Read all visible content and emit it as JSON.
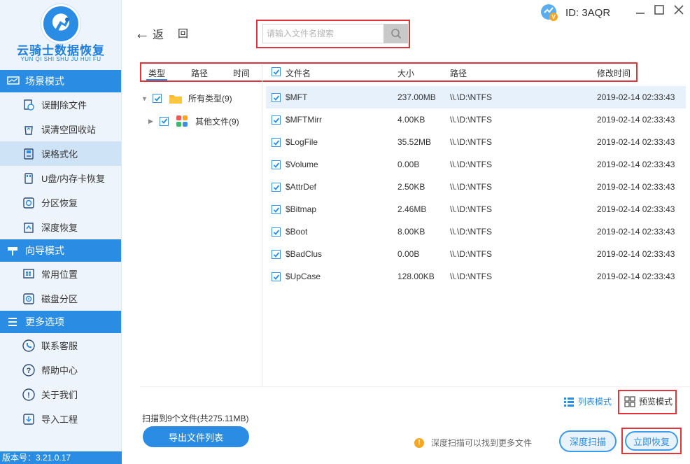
{
  "app": {
    "logo_title": "云骑士数据恢复",
    "logo_subtitle": "YUN QI SHI SHU JU HUI FU",
    "version": "版本号：3.21.0.17",
    "user_id": "ID: 3AQR"
  },
  "sidebar": {
    "sections": [
      {
        "title": "场景模式",
        "items": [
          {
            "label": "误删除文件",
            "icon": "deleted-file-icon"
          },
          {
            "label": "误清空回收站",
            "icon": "recycle-bin-icon"
          },
          {
            "label": "误格式化",
            "icon": "format-drive-icon",
            "active": true
          },
          {
            "label": "U盘/内存卡恢复",
            "icon": "usb-card-icon"
          },
          {
            "label": "分区恢复",
            "icon": "partition-icon"
          },
          {
            "label": "深度恢复",
            "icon": "deep-recover-icon"
          }
        ]
      },
      {
        "title": "向导模式",
        "items": [
          {
            "label": "常用位置",
            "icon": "windows-icon"
          },
          {
            "label": "磁盘分区",
            "icon": "disk-icon"
          }
        ]
      },
      {
        "title": "更多选项",
        "items": [
          {
            "label": "联系客服",
            "icon": "phone-icon"
          },
          {
            "label": "帮助中心",
            "icon": "help-icon"
          },
          {
            "label": "关于我们",
            "icon": "info-icon"
          },
          {
            "label": "导入工程",
            "icon": "import-icon"
          }
        ]
      }
    ]
  },
  "toolbar": {
    "back_label": "返",
    "undo_label": "回",
    "search_placeholder": "请输入文件名搜索"
  },
  "filter_headers": {
    "type": "类型",
    "path": "路径",
    "time": "时间"
  },
  "tree": [
    {
      "label": "所有类型(9)",
      "checked": true,
      "expanded": true
    },
    {
      "label": "其他文件(9)",
      "checked": true,
      "expanded": false
    }
  ],
  "table": {
    "headers": {
      "name": "文件名",
      "size": "大小",
      "path": "路径",
      "modified": "修改时间"
    },
    "rows": [
      {
        "name": "$MFT",
        "size": "237.00MB",
        "path": "\\\\.\\D:\\NTFS",
        "modified": "2019-02-14 02:33:43",
        "selected": true
      },
      {
        "name": "$MFTMirr",
        "size": "4.00KB",
        "path": "\\\\.\\D:\\NTFS",
        "modified": "2019-02-14 02:33:43"
      },
      {
        "name": "$LogFile",
        "size": "35.52MB",
        "path": "\\\\.\\D:\\NTFS",
        "modified": "2019-02-14 02:33:43"
      },
      {
        "name": "$Volume",
        "size": "0.00B",
        "path": "\\\\.\\D:\\NTFS",
        "modified": "2019-02-14 02:33:43"
      },
      {
        "name": "$AttrDef",
        "size": "2.50KB",
        "path": "\\\\.\\D:\\NTFS",
        "modified": "2019-02-14 02:33:43"
      },
      {
        "name": "$Bitmap",
        "size": "2.46MB",
        "path": "\\\\.\\D:\\NTFS",
        "modified": "2019-02-14 02:33:43"
      },
      {
        "name": "$Boot",
        "size": "8.00KB",
        "path": "\\\\.\\D:\\NTFS",
        "modified": "2019-02-14 02:33:43"
      },
      {
        "name": "$BadClus",
        "size": "0.00B",
        "path": "\\\\.\\D:\\NTFS",
        "modified": "2019-02-14 02:33:43"
      },
      {
        "name": "$UpCase",
        "size": "128.00KB",
        "path": "\\\\.\\D:\\NTFS",
        "modified": "2019-02-14 02:33:43"
      }
    ]
  },
  "footer": {
    "scan_summary": "扫描到9个文件(共275.11MB)",
    "export_button": "导出文件列表",
    "tip": "深度扫描可以找到更多文件",
    "deep_scan_button": "深度扫描",
    "recover_button": "立即恢复",
    "view_list": "列表模式",
    "view_preview": "预览模式"
  },
  "colors": {
    "accent": "#2a8de3",
    "highlight": "#e0353a",
    "selected_row": "#e6f1fc"
  }
}
